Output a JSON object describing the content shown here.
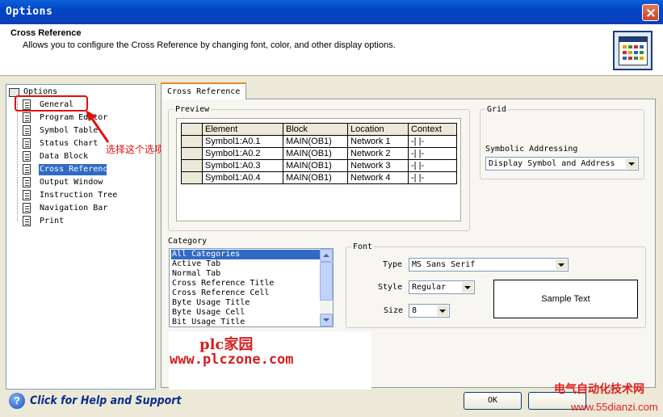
{
  "window": {
    "title": "Options"
  },
  "header": {
    "title": "Cross Reference",
    "description": "Allows you to configure the Cross Reference by changing font, color, and other display options."
  },
  "tree": {
    "root": "Options",
    "items": [
      {
        "label": "General",
        "selected": false
      },
      {
        "label": "Program Editor",
        "selected": false
      },
      {
        "label": "Symbol Table",
        "selected": false
      },
      {
        "label": "Status Chart",
        "selected": false
      },
      {
        "label": "Data Block",
        "selected": false
      },
      {
        "label": "Cross Reference",
        "selected": true
      },
      {
        "label": "Output Window",
        "selected": false
      },
      {
        "label": "Instruction Tree",
        "selected": false
      },
      {
        "label": "Navigation Bar",
        "selected": false
      },
      {
        "label": "Print",
        "selected": false
      }
    ]
  },
  "annotation": {
    "text": "选择这个选项",
    "color": "#e01010"
  },
  "tab": {
    "label": "Cross Reference"
  },
  "preview": {
    "legend": "Preview",
    "columns": [
      "Element",
      "Block",
      "Location",
      "Context"
    ],
    "rows": [
      [
        "Symbol1:A0.1",
        "MAIN(OB1)",
        "Network 1",
        "-| |-"
      ],
      [
        "Symbol1:A0.2",
        "MAIN(OB1)",
        "Network 2",
        "-| |-"
      ],
      [
        "Symbol1:A0.3",
        "MAIN(OB1)",
        "Network 3",
        "-| |-"
      ],
      [
        "Symbol1:A0.4",
        "MAIN(OB1)",
        "Network 4",
        "-| |-"
      ]
    ]
  },
  "grid": {
    "legend": "Grid",
    "symbolic_label": "Symbolic Addressing",
    "symbolic_value": "Display Symbol and Address"
  },
  "category": {
    "legend": "Category",
    "items": [
      "All Categories",
      "Active Tab",
      "Normal Tab",
      "Cross Reference Title",
      "Cross Reference Cell",
      "Byte Usage Title",
      "Byte Usage Cell",
      "Bit Usage Title"
    ],
    "selected_index": 0
  },
  "font": {
    "legend": "Font",
    "type_label": "Type",
    "type_value": "MS Sans Serif",
    "style_label": "Style",
    "style_value": "Regular",
    "size_label": "Size",
    "size_value": "8",
    "sample": "Sample Text"
  },
  "watermark": {
    "line1": "plc家园",
    "line2": "www.plczone.com",
    "line3": "电气自动化技术网",
    "line4": "www.55dianzi.com"
  },
  "footer": {
    "help_text": "Click for Help and Support",
    "ok_label": "OK"
  },
  "colors": {
    "title_bar": "#0246c4",
    "selection": "#316ac5",
    "annotation": "#e01010"
  }
}
